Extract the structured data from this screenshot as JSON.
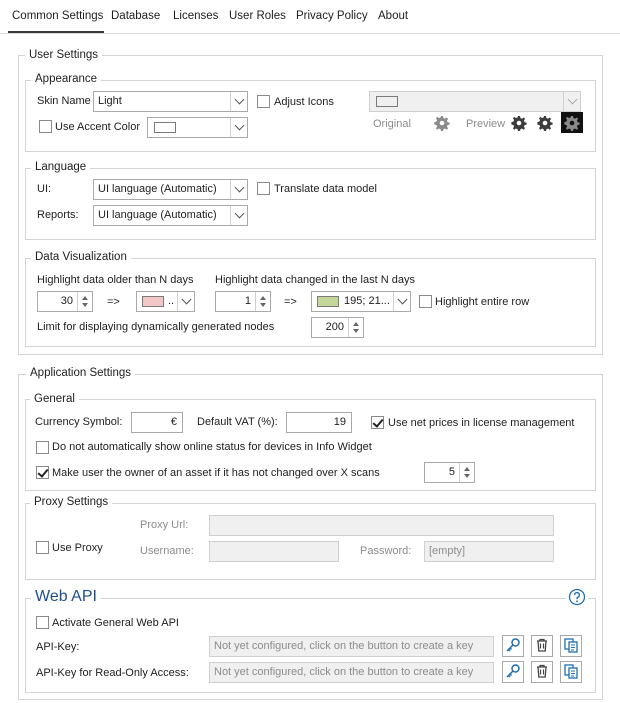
{
  "tabs": [
    "Common Settings",
    "Database",
    "Licenses",
    "User Roles",
    "Privacy Policy",
    "About"
  ],
  "user_settings": {
    "title": "User Settings",
    "appearance": {
      "title": "Appearance",
      "skin_label": "Skin Name",
      "skin_value": "Light",
      "adjust_icons_label": "Adjust Icons",
      "use_accent_label": "Use Accent Color",
      "original_label": "Original",
      "preview_label": "Preview"
    },
    "language": {
      "title": "Language",
      "ui_label": "UI:",
      "ui_value": "UI language (Automatic)",
      "reports_label": "Reports:",
      "reports_value": "UI language (Automatic)",
      "translate_label": "Translate data model"
    },
    "data_visualization": {
      "title": "Data Visualization",
      "older_label": "Highlight data older than N days",
      "older_value": "30",
      "arrow1": "=>",
      "older_color_text": "..",
      "changed_label": "Highlight data changed in the last N days",
      "changed_value": "1",
      "arrow2": "=>",
      "changed_color_text": "195; 21...",
      "highlight_row_label": "Highlight entire row",
      "limit_label": "Limit for displaying dynamically generated nodes",
      "limit_value": "200"
    }
  },
  "application_settings": {
    "title": "Application Settings",
    "general": {
      "title": "General",
      "currency_label": "Currency Symbol:",
      "currency_value": "€",
      "vat_label": "Default VAT (%):",
      "vat_value": "19",
      "net_prices_label": "Use net prices in license management",
      "no_online_status_label": "Do not automatically show online status for devices in Info Widget",
      "owner_label": "Make user the owner of an asset if it has not changed over X scans",
      "owner_value": "5"
    },
    "proxy": {
      "title": "Proxy Settings",
      "use_proxy_label": "Use Proxy",
      "url_label": "Proxy Url:",
      "username_label": "Username:",
      "password_label": "Password:",
      "password_placeholder": "[empty]"
    },
    "web_api": {
      "title": "Web API",
      "activate_label": "Activate General Web API",
      "api_key_label": "API-Key:",
      "api_key_placeholder": "Not yet configured, click on the button to create a key",
      "ro_key_label": "API-Key for Read-Only Access:",
      "ro_key_placeholder": "Not yet configured, click on the button to create a key"
    }
  },
  "colors": {
    "older_swatch": "#f4c7c7",
    "changed_swatch": "#c3d79b",
    "webapi_title": "#1f4e8c"
  },
  "icons": [
    "gear-icon",
    "key-icon",
    "trash-icon",
    "copy-icon",
    "help-icon",
    "chevron-down-icon",
    "checkmark-icon"
  ]
}
